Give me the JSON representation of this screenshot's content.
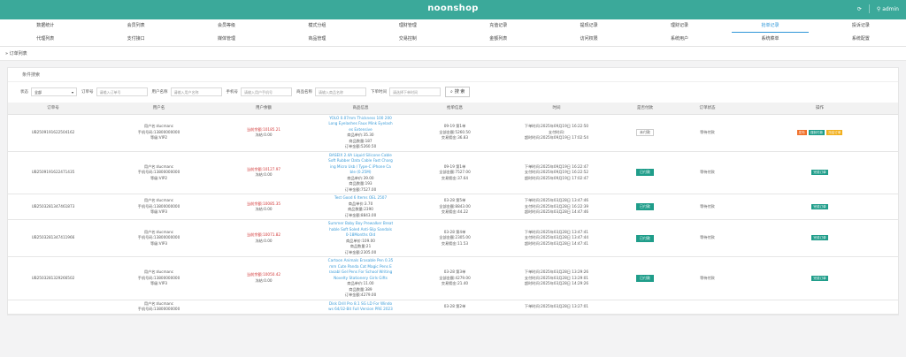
{
  "header": {
    "brand": "noonshop",
    "refresh_icon": "refresh-icon",
    "admin": "admin"
  },
  "nav_row1": [
    "数据统计",
    "会员列表",
    "会员等级",
    "模式分组",
    "理财管理",
    "充值记录",
    "提现记录",
    "理财记录",
    "抢单记录",
    "投诉记录"
  ],
  "nav_row2": [
    "代理列表",
    "支付接口",
    "媒体管理",
    "商品管理",
    "交易控制",
    "金额列表",
    "访问权限",
    "系统用户",
    "系统菜单",
    "系统配置"
  ],
  "active_nav": "抢单记录",
  "breadcrumb": "订单列表",
  "panel_title": "条件搜索",
  "filters": {
    "status_label": "状态",
    "status_value": "全部",
    "order_label": "订单号",
    "order_ph": "请输入订单号",
    "user_label": "用户名称",
    "user_ph": "请输入用户名称",
    "phone_label": "手机号",
    "phone_ph": "请输入用户手机号",
    "goods_label": "商品名称",
    "goods_ph": "请输入商品名称",
    "time_label": "下单时间",
    "time_ph": "请选择下单时间",
    "search_label": "搜 索"
  },
  "columns": [
    "订单号",
    "用户名",
    "用户余额",
    "商品信息",
    "抢单信息",
    "时间",
    "是否付款",
    "订单状态",
    "操作"
  ],
  "rows": [
    {
      "order_id": "UB2509191622504162",
      "user": [
        "用户名:ducmanc",
        "手机号码:13800000000",
        "等级:VIP2"
      ],
      "balance": "当前余额:10185.21",
      "frozen": "冻结:0.00",
      "goods": [
        "YOLO 0.07mm Thickness 100 200",
        "Long Eyelashes Faux Mink Eyelash",
        "es Extensive"
      ],
      "goods_meta": [
        "商品单价:35.30",
        "商品数量:187",
        "订单金额:5260.50"
      ],
      "grab": [
        "09-19 第1单",
        "全部金额:5260.50",
        "交易佣金:36.83"
      ],
      "times": [
        "下单时间:2025年09月19日 16:22:50",
        "支付时间:",
        "超时时间:2025年09月19日 17:02:54"
      ],
      "paid": "未付款",
      "paid_state": "unpaid",
      "state": "等待付款",
      "ops": [
        {
          "label": "发布",
          "color": "red"
        },
        {
          "label": "强制付款",
          "color": "green"
        },
        {
          "label": "冻结订单",
          "color": "yellow"
        }
      ]
    },
    {
      "order_id": "UB2509191622471435",
      "user": [
        "用户名:ducmanc",
        "手机号码:13800000000",
        "等级:VIP2"
      ],
      "balance": "当前余额:10127.97",
      "frozen": "冻结:0.00",
      "goods": [
        "BASEIX 2.4A Liquid Silicone Cable",
        "Soft Rubber Data Cable Fast Charg",
        "ing Micro Usb / Type-C iPhone Ca",
        "ble (0.25M)"
      ],
      "goods_meta": [
        "商品单价:39.00",
        "商品数量:193",
        "订单金额:7527.00"
      ],
      "grab": [
        "09-19 第1单",
        "全部金额:7527.00",
        "交易佣金:37.64"
      ],
      "times": [
        "下单时间:2025年09月19日 16:22:47",
        "支付时间:2025年09月19日 16:22:52",
        "超时时间:2025年09月19日 17:02:47"
      ],
      "paid": "已付款",
      "paid_state": "paid",
      "state": "等待付款",
      "ops": [
        {
          "label": "完成订单",
          "color": "green"
        }
      ]
    },
    {
      "order_id": "UB2503281347461873",
      "user": [
        "用户名:ducmanc",
        "手机号码:13800000000",
        "等级:VIP3"
      ],
      "balance": "当前余额:10085.35",
      "frozen": "冻结:0.00",
      "goods": [
        "Test Good 6 Items OEL 2507"
      ],
      "goods_meta": [
        "商品单价:3.70",
        "商品数量:2390",
        "订单金额:8843.00"
      ],
      "grab": [
        "03-28 第5单",
        "全部金额:8843.00",
        "交易佣金:44.22"
      ],
      "times": [
        "下单时间:2025年03月28日 13:47:46",
        "支付时间:2025年03月28日 16:22:39",
        "超时时间:2025年03月28日 14:47:46"
      ],
      "paid": "已付款",
      "paid_state": "paid",
      "state": "等待付款",
      "ops": [
        {
          "label": "完成订单",
          "color": "green"
        }
      ]
    },
    {
      "order_id": "UB2503281347411966",
      "user": [
        "用户名:ducmanc",
        "手机号码:13800000000",
        "等级:VIP3"
      ],
      "balance": "当前余额:10071.82",
      "frozen": "冻结:0.00",
      "goods": [
        "Summer Baby Boy Prewalker Breat",
        "hable Soft Soled Anti-Slip Sandals",
        "0-18Months Old"
      ],
      "goods_meta": [
        "商品单价:109.00",
        "商品数量:21",
        "订单金额:2305.00"
      ],
      "grab": [
        "03-28 第4单",
        "全部金额:2305.00",
        "交易佣金:11.53"
      ],
      "times": [
        "下单时间:2025年03月28日 13:47:41",
        "支付时间:2025年03月28日 13:47:44",
        "超时时间:2025年03月28日 14:47:41"
      ],
      "paid": "已付款",
      "paid_state": "paid",
      "state": "等待付款",
      "ops": [
        {
          "label": "完成订单",
          "color": "green"
        }
      ]
    },
    {
      "order_id": "UB2503281329266502",
      "user": [
        "用户名:ducmanc",
        "手机号码:13800000000",
        "等级:VIP3"
      ],
      "balance": "当前余额:10050.42",
      "frozen": "冻结:0.00",
      "goods": [
        "Cartoon Animals Erasable Pen 0.35",
        "mm Cute Panda Cat Magic Pens E",
        "rasabl Gel Pens For School Writing",
        "Novelty Stationery Girls Gifts"
      ],
      "goods_meta": [
        "商品单价:11.00",
        "商品数量:389",
        "订单金额:4279.00"
      ],
      "grab": [
        "03-28 第3单",
        "全部金额:4279.00",
        "交易佣金:21.40"
      ],
      "times": [
        "下单时间:2025年03月28日 13:29:26",
        "支付时间:2025年03月28日 13:29:01",
        "超时时间:2025年03月28日 14:29:26"
      ],
      "paid": "已付款",
      "paid_state": "paid",
      "state": "等待付款",
      "ops": [
        {
          "label": "完成订单",
          "color": "green"
        }
      ]
    },
    {
      "order_id": "",
      "user": [
        "用户名:ducmanc",
        "手机号码:13800000000",
        ""
      ],
      "balance": "",
      "frozen": "",
      "goods": [
        "Disk Drill Pro 8.1 SG LD For Windo",
        "ws 64/32-Bit Full Version PRE 2023"
      ],
      "goods_meta": [],
      "grab": [
        "03-28 第2单",
        "",
        ""
      ],
      "times": [
        "下单时间:2025年03月28日 13:27:01",
        "",
        ""
      ],
      "paid": "",
      "paid_state": "none",
      "state": "",
      "ops": []
    }
  ],
  "colors": {
    "header": "#3ba99a",
    "link": "#3a9bd8",
    "paid": "#1f9d8a",
    "money": "#d23b3b"
  }
}
